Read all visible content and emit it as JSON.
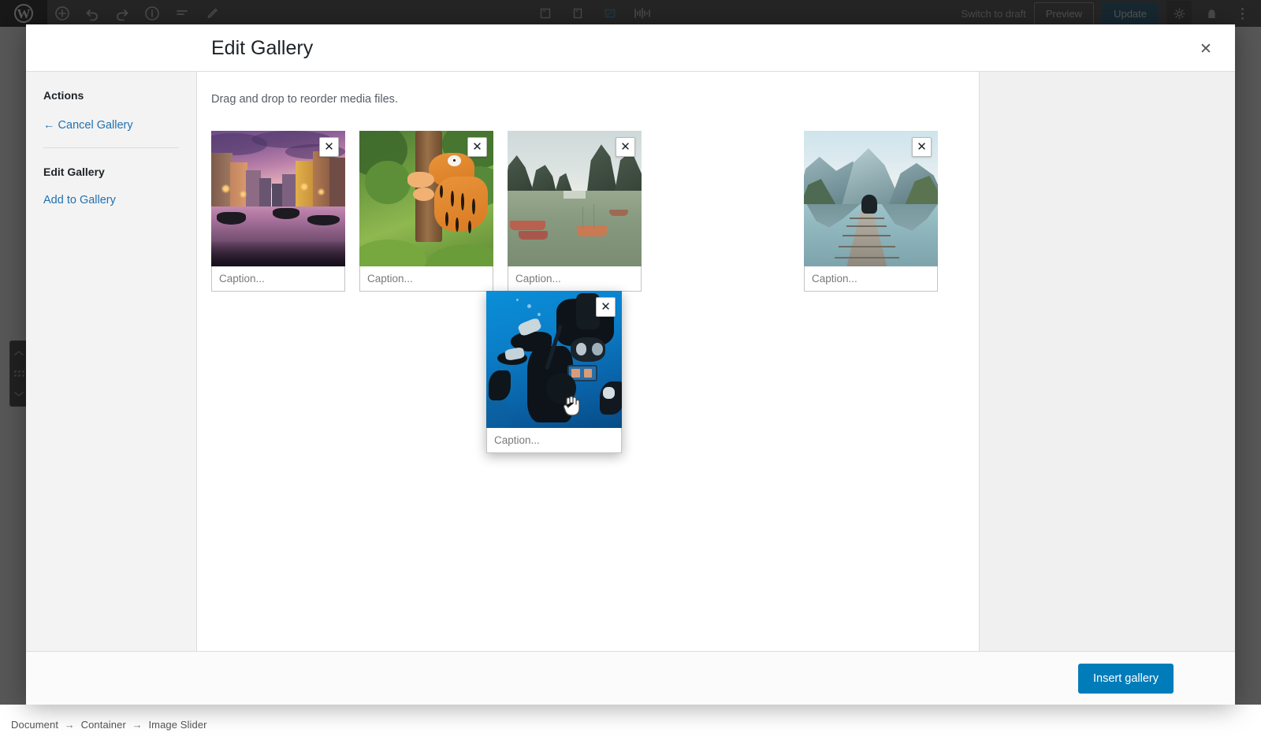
{
  "editor": {
    "logo_icon": "wordpress-logo",
    "toolbar_icons": [
      "add-block-icon",
      "undo-icon",
      "redo-icon",
      "details-icon",
      "list-view-icon",
      "edit-pencil-icon"
    ],
    "center_icons": [
      "desktop-view-icon",
      "tablet-view-icon",
      "mobile-view-icon",
      "responsive-icon"
    ],
    "switch_to_draft_label": "Switch to draft",
    "preview_label": "Preview",
    "update_label": "Update",
    "settings_icon": "gear-icon",
    "plugins_icon": "plugins-icon",
    "more_options_icon": "kebab-menu-icon",
    "close_icon": "close-icon",
    "block_mover": {
      "move_up_icon": "chevron-up-icon",
      "drag_handle_icon": "drag-dots-icon",
      "move_down_icon": "chevron-down-icon"
    }
  },
  "status_bar": {
    "breadcrumb": [
      "Document",
      "Container",
      "Image Slider"
    ],
    "separator": "→"
  },
  "modal": {
    "title": "Edit Gallery",
    "close_icon": "close-icon",
    "close_label": "✕",
    "sidebar": {
      "actions_heading": "Actions",
      "cancel_gallery_label": "← Cancel Gallery",
      "edit_gallery_heading": "Edit Gallery",
      "add_to_gallery_label": "Add to Gallery"
    },
    "main": {
      "drag_hint": "Drag and drop to reorder media files.",
      "caption_placeholder": "Caption...",
      "remove_icon": "close-icon",
      "remove_label": "✕"
    },
    "footer": {
      "insert_gallery_label": "Insert gallery",
      "accent_color": "#007cba"
    }
  },
  "gallery_items": [
    {
      "name": "venice-canal-thumbnail",
      "caption": "",
      "placeholder": "Caption..."
    },
    {
      "name": "tiger-tree-thumbnail",
      "caption": "",
      "placeholder": "Caption..."
    },
    {
      "name": "halong-bay-thumbnail",
      "caption": "",
      "placeholder": "Caption..."
    },
    {
      "name": "empty-drop-slot",
      "caption": "",
      "placeholder": "Caption..."
    },
    {
      "name": "mountain-lake-thumbnail",
      "caption": "",
      "placeholder": "Caption..."
    }
  ],
  "dragged_item": {
    "name": "scuba-diver-thumbnail",
    "caption": "",
    "placeholder": "Caption...",
    "cursor_icon": "grabbing-hand-cursor"
  }
}
